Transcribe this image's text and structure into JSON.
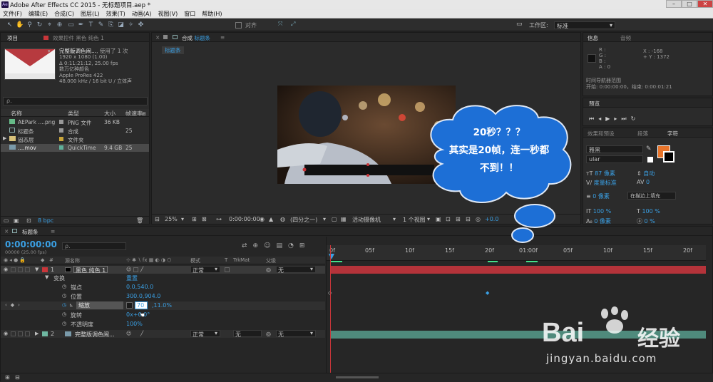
{
  "window": {
    "title": "Adobe After Effects CC 2015 - 无标题项目.aep *",
    "app_icon": "Ae"
  },
  "menu": [
    "文件(F)",
    "编辑(E)",
    "合成(C)",
    "图层(L)",
    "效果(T)",
    "动画(A)",
    "视图(V)",
    "窗口",
    "帮助(H)"
  ],
  "toolbar": {
    "snap_label": "对齐",
    "workspace_label": "工作区:",
    "workspace_value": "标准"
  },
  "project": {
    "tab": "项目",
    "effects_tab": "效果控件 黑色 纯色 1",
    "item_name": "完整版调色闹...",
    "item_used": ", 使用了 1 次",
    "item_lines": [
      "1920 x 1080 (1.00)",
      "Δ 0:11:21:12, 25.00 fps",
      "数万亿种颜色",
      "Apple ProRes 422",
      "48.000 kHz / 16 bit U / 立体声"
    ],
    "search_placeholder": "ρ.",
    "columns": [
      "名称",
      "类型",
      "大小",
      "帧速率"
    ],
    "rows": [
      {
        "name": "AEPark ....png",
        "type": "PNG 文件",
        "size": "36 KB",
        "fps": ""
      },
      {
        "name": "标题条",
        "type": "合成",
        "size": "",
        "fps": "25"
      },
      {
        "name": "固态层",
        "type": "文件夹",
        "size": "",
        "fps": ""
      },
      {
        "name": "....mov",
        "type": "QuickTime",
        "size": "9.4 GB",
        "fps": "25"
      }
    ],
    "bpc": "8 bpc"
  },
  "comp": {
    "tab": "合成",
    "tab_name": "标题条",
    "breadcrumb": "标题条",
    "zoom": "25%",
    "timecode": "0:00:00:00",
    "resolution": "(四分之一)",
    "camera": "活动摄像机",
    "views": "1 个视图",
    "exposure": "+0.0"
  },
  "callout": {
    "line1": "20秒？？？",
    "line2": "其实是20帧，连一秒都",
    "line3": "不到！！"
  },
  "info": {
    "tab": "信息",
    "audio_tab": "音频",
    "rgb": [
      "R :",
      "G :",
      "B :",
      "A : 0"
    ],
    "x": "X : -168",
    "y": "+ Y : 1372",
    "nav_label": "时间导航器范围",
    "nav_range": "开始: 0:00:00:00，结束: 0:00:01:21"
  },
  "preview": {
    "tab": "预览"
  },
  "character": {
    "tab_effects": "效果和预设",
    "tab_para": "段落",
    "tab_char": "字符",
    "font": "雅黑",
    "style": "ular",
    "size": "87 像素",
    "leading": "自动",
    "kerning": "度量标准",
    "tracking": "0",
    "stroke_px": "0 像素",
    "stroke_mode": "在描边上填充",
    "vscale": "100 %",
    "hscale": "100 %",
    "baseline": "0 像素",
    "tsume": "0 %"
  },
  "timeline": {
    "tab": "标题条",
    "timecode": "0:00:00:00",
    "frame_info": "00000 (25.00 fps)",
    "search_placeholder": "ρ.",
    "columns": {
      "num": "#",
      "name": "源名称",
      "mode": "模式",
      "t": "T",
      "trkmat": "TrkMat",
      "parent": "父级"
    },
    "ruler": [
      "0f",
      "05f",
      "10f",
      "15f",
      "20f",
      "01:00f",
      "05f",
      "10f",
      "15f",
      "20f"
    ],
    "layers": [
      {
        "num": "1",
        "name": "黑色 纯色 1",
        "mode": "正常",
        "trkmat": "",
        "parent": "无",
        "color": "#c9363a"
      },
      {
        "num": "2",
        "name": "完整版调色闹...",
        "mode": "正常",
        "trkmat": "无",
        "parent": "无",
        "color": "#6fb8a2"
      }
    ],
    "transform": {
      "label": "变换",
      "reset": "重置",
      "anchor_label": "锚点",
      "anchor_value": "0.0,540.0",
      "position_label": "位置",
      "position_value": "300.0,904.0",
      "scale_label": "缩放",
      "scale_value_x": "70",
      "scale_value_y": ",11.0%",
      "rotation_label": "旋转",
      "rotation_value": "0x+0.0°",
      "opacity_label": "不透明度",
      "opacity_value": "100%"
    }
  },
  "watermark": {
    "brand": "Bai",
    "brand2": "经验",
    "url": "jingyan.baidu.com"
  },
  "colors": {
    "accent": "#3a9fe3",
    "layer1": "#c9363a",
    "layer2": "#6fb8a2",
    "cloud": "#1d6fd6"
  }
}
